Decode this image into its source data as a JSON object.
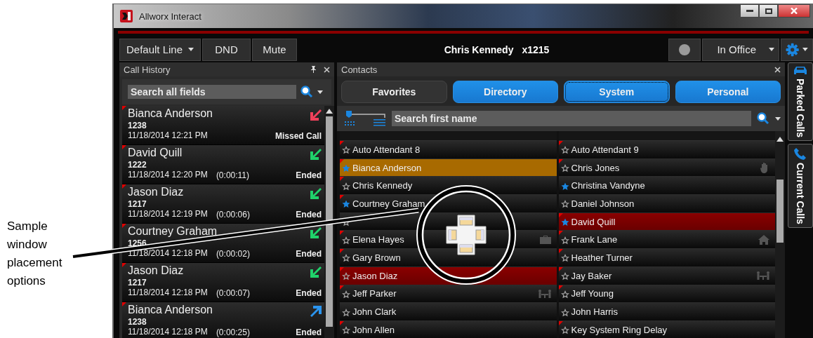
{
  "caption": "Sample window placement options",
  "window": {
    "title": "Allworx Interact"
  },
  "toolbar": {
    "line_button": "Default Line",
    "dnd_button": "DND",
    "mute_button": "Mute",
    "user": "Chris Kennedy",
    "extension": "x1215",
    "presence": "In Office"
  },
  "call_history": {
    "title": "Call History",
    "search": {
      "placeholder": "Search all fields"
    },
    "calls": [
      {
        "name": "Bianca Anderson",
        "number": "1238",
        "time": "11/18/2014 12:21 PM",
        "result": "Missed Call",
        "missed": true,
        "outgoing": false
      },
      {
        "name": "David Quill",
        "number": "1222",
        "time": "11/18/2014 12:20 PM",
        "duration": "(0:00:11)",
        "result": "Ended",
        "missed": false,
        "outgoing": false
      },
      {
        "name": "Jason Diaz",
        "number": "1217",
        "time": "11/18/2014 12:19 PM",
        "duration": "(0:00:06)",
        "result": "Ended",
        "missed": false,
        "outgoing": false
      },
      {
        "name": "Courtney Graham",
        "number": "1256",
        "time": "11/18/2014 12:18 PM",
        "duration": "(0:00:02)",
        "result": "Ended",
        "missed": false,
        "outgoing": false
      },
      {
        "name": "Jason Diaz",
        "number": "1217",
        "time": "11/18/2014 12:18 PM",
        "duration": "(0:00:07)",
        "result": "Ended",
        "missed": false,
        "outgoing": false
      },
      {
        "name": "Bianca Anderson",
        "number": "1238",
        "time": "11/18/2014 12:18 PM",
        "duration": "(0:00:25)",
        "result": "Ended",
        "missed": false,
        "outgoing": true
      }
    ]
  },
  "contacts": {
    "title": "Contacts",
    "tabs": [
      {
        "label": "Favorites",
        "selected": false,
        "focused": false
      },
      {
        "label": "Directory",
        "selected": true,
        "focused": false
      },
      {
        "label": "System",
        "selected": true,
        "focused": true
      },
      {
        "label": "Personal",
        "selected": true,
        "focused": false
      }
    ],
    "view_size_slider": {
      "level": 0
    },
    "search": {
      "placeholder": "Search first name"
    },
    "entries": [
      {
        "name": "Auto Attendant 8",
        "favorite": false,
        "flag": true,
        "selected": false,
        "busy": false,
        "kind": "plain"
      },
      {
        "name": "Auto Attendant 9",
        "favorite": false,
        "flag": true,
        "selected": false,
        "busy": false,
        "kind": "plain"
      },
      {
        "name": "Bianca Anderson",
        "favorite": true,
        "flag": true,
        "selected": true,
        "busy": false,
        "kind": "plain"
      },
      {
        "name": "Chris Jones",
        "favorite": false,
        "flag": true,
        "selected": false,
        "busy": false,
        "kind": "hand"
      },
      {
        "name": "Chris Kennedy",
        "favorite": false,
        "flag": true,
        "selected": false,
        "busy": false,
        "kind": "plain"
      },
      {
        "name": "Christina Vandyne",
        "favorite": true,
        "flag": false,
        "selected": false,
        "busy": false,
        "kind": "plain"
      },
      {
        "name": "Courtney Graham",
        "favorite": true,
        "flag": true,
        "selected": false,
        "busy": false,
        "kind": "plain"
      },
      {
        "name": "Daniel Johnson",
        "favorite": false,
        "flag": false,
        "selected": false,
        "busy": false,
        "kind": "plain"
      },
      {
        "favorite": false,
        "flag": false,
        "selected": false,
        "busy": false,
        "kind": "plain"
      },
      {
        "name": "David Quill",
        "favorite": true,
        "flag": true,
        "selected": false,
        "busy": true,
        "kind": "plain"
      },
      {
        "name": "Elena Hayes",
        "favorite": false,
        "flag": true,
        "selected": false,
        "busy": false,
        "kind": "work"
      },
      {
        "name": "Frank Lane",
        "favorite": false,
        "flag": true,
        "selected": false,
        "busy": false,
        "kind": "home"
      },
      {
        "name": "Gary Brown",
        "favorite": false,
        "flag": true,
        "selected": false,
        "busy": false,
        "kind": "plain"
      },
      {
        "name": "Heather Turner",
        "favorite": false,
        "flag": true,
        "selected": false,
        "busy": false,
        "kind": "plain"
      },
      {
        "name": "Jason Diaz",
        "favorite": false,
        "flag": true,
        "selected": false,
        "busy": true,
        "kind": "plain"
      },
      {
        "name": "Jay Baker",
        "favorite": false,
        "flag": true,
        "selected": false,
        "busy": false,
        "kind": "meeting"
      },
      {
        "name": "Jeff Parker",
        "favorite": false,
        "flag": true,
        "selected": false,
        "busy": false,
        "kind": "meeting"
      },
      {
        "name": "Jeff Young",
        "favorite": false,
        "flag": true,
        "selected": false,
        "busy": false,
        "kind": "plain"
      },
      {
        "name": "John Clark",
        "favorite": false,
        "flag": false,
        "selected": false,
        "busy": false,
        "kind": "plain"
      },
      {
        "name": "John Harris",
        "favorite": false,
        "flag": false,
        "selected": false,
        "busy": false,
        "kind": "plain"
      },
      {
        "name": "John Allen",
        "favorite": false,
        "flag": true,
        "selected": false,
        "busy": false,
        "kind": "plain"
      },
      {
        "name": "Key System Ring Delay",
        "favorite": false,
        "flag": true,
        "selected": false,
        "busy": false,
        "kind": "plain"
      }
    ]
  },
  "side_tabs": [
    {
      "label": "Parked Calls",
      "kind": "parked"
    },
    {
      "label": "Current Calls",
      "kind": "current"
    }
  ]
}
